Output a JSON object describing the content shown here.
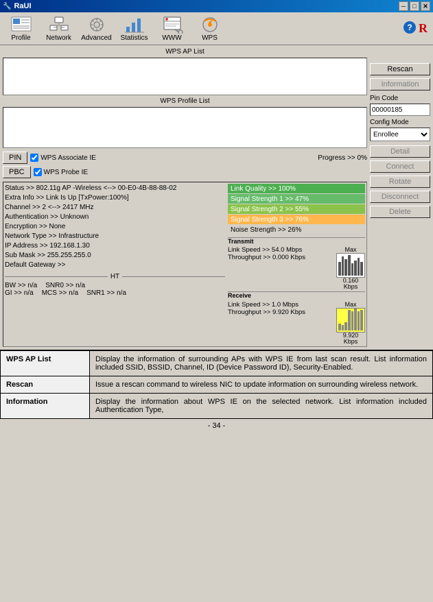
{
  "titleBar": {
    "title": "RaUI",
    "closeBtn": "✕",
    "minBtn": "─",
    "maxBtn": "□"
  },
  "toolbar": {
    "items": [
      {
        "id": "profile",
        "label": "Profile",
        "icon": "profile"
      },
      {
        "id": "network",
        "label": "Network",
        "icon": "network"
      },
      {
        "id": "advanced",
        "label": "Advanced",
        "icon": "advanced"
      },
      {
        "id": "statistics",
        "label": "Statistics",
        "icon": "statistics"
      },
      {
        "id": "www",
        "label": "WWW",
        "icon": "www"
      },
      {
        "id": "wps",
        "label": "WPS",
        "icon": "wps"
      }
    ]
  },
  "wpsPanel": {
    "apListLabel": "WPS AP List",
    "profileListLabel": "WPS Profile List",
    "buttons": {
      "rescan": "Rescan",
      "information": "Information",
      "pinCode": "Pin Code",
      "pinCodeValue": "00000185",
      "configMode": "Config Mode",
      "configModeValue": "Enrollee",
      "detail": "Detail",
      "connect": "Connect",
      "rotate": "Rotate",
      "disconnect": "Disconnect",
      "delete": "Delete"
    },
    "pinLabel": "PIN",
    "pbcLabel": "PBC",
    "wpsAssociateIE": "WPS Associate IE",
    "wpsProbeIE": "WPS Probe IE",
    "progressLabel": "Progress >> 0%"
  },
  "statusInfo": {
    "lines": [
      "Status >> 802.11g AP -Wireless  <--> 00-E0-4B-88-88-02",
      "Extra Info >> Link Is Up [TxPower:100%]",
      "Channel >> 2 <--> 2417 MHz",
      "Authentication >> Unknown",
      "Encryption >> None",
      "Network Type >> Infrastructure",
      "IP Address >> 192.168.1.30",
      "Sub Mask >> 255.255.255.0",
      "Default Gateway >>"
    ],
    "signals": [
      {
        "label": "Link Quality >> 100%",
        "color": "green"
      },
      {
        "label": "Signal Strength 1 >> 47%",
        "color": "green"
      },
      {
        "label": "Signal Strength 2 >> 55%",
        "color": "yellowgreen"
      },
      {
        "label": "Signal Strength 3 >> 76%",
        "color": "orange"
      }
    ],
    "noiseLabel": "Noise Strength >> 26%",
    "transmit": {
      "label": "Transmit",
      "linkSpeed": "Link Speed >> 54.0 Mbps",
      "throughput": "Throughput >> 0.000 Kbps",
      "maxLabel": "Max",
      "kbpsValue": "0.160",
      "kbpsUnit": "Kbps"
    },
    "receive": {
      "label": "Receive",
      "linkSpeed": "Link Speed >> 1.0 Mbps",
      "throughput": "Throughput >> 9.920 Kbps",
      "maxLabel": "Max",
      "kbpsValue": "9.920",
      "kbpsUnit": "Kbps"
    },
    "ht": "HT",
    "hwRows": [
      {
        "label": "BW >>",
        "value": "n/a"
      },
      {
        "label": "GI >>",
        "value": "n/a"
      }
    ],
    "snrRows": [
      {
        "label": "SNR0 >>",
        "value": "n/a"
      },
      {
        "label": "SNR1 >>",
        "value": "n/a"
      }
    ],
    "mcsRow": {
      "label": "MCS >>",
      "value": "n/a"
    }
  },
  "infoTable": {
    "rows": [
      {
        "term": "WPS AP List",
        "def": "Display the information of surrounding APs with WPS IE from last scan result. List information included SSID, BSSID, Channel, ID (Device Password ID), Security-Enabled."
      },
      {
        "term": "Rescan",
        "def": "Issue a rescan command to wireless NIC to update information on surrounding wireless network."
      },
      {
        "term": "Information",
        "def": "Display the information about WPS IE on the selected network. List information included Authentication Type,"
      }
    ]
  },
  "pageNumber": "- 34 -"
}
